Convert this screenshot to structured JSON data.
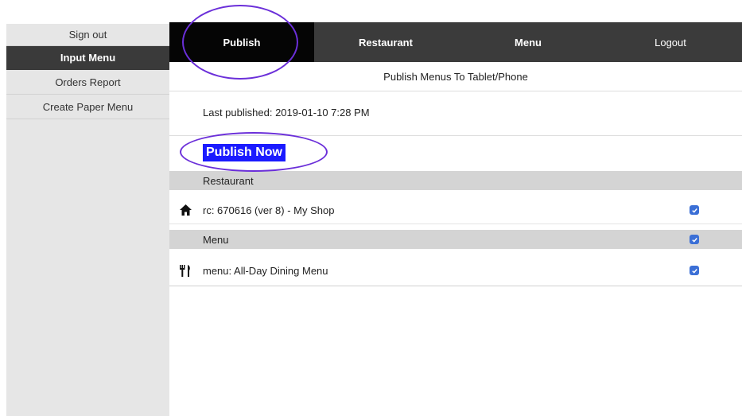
{
  "sidebar": {
    "items": [
      {
        "label": "Sign out"
      },
      {
        "label": "Input Menu"
      },
      {
        "label": "Orders Report"
      },
      {
        "label": "Create Paper Menu"
      }
    ]
  },
  "topnav": {
    "items": [
      {
        "label": "Publish"
      },
      {
        "label": "Restaurant"
      },
      {
        "label": "Menu"
      },
      {
        "label": "Logout"
      }
    ]
  },
  "main": {
    "subtitle": "Publish Menus To Tablet/Phone",
    "last_published": "Last published: 2019-01-10 7:28 PM",
    "publish_button": "Publish Now",
    "restaurant_section": "Restaurant",
    "restaurant_item": "rc: 670616 (ver 8) - My Shop",
    "menu_section": "Menu",
    "menu_item": "menu: All-Day Dining Menu"
  },
  "colors": {
    "accent": "#1a1aff",
    "annotation": "#6b2fd9",
    "nav_bg": "#3b3b3b",
    "checkbox": "#3b6fd6"
  }
}
